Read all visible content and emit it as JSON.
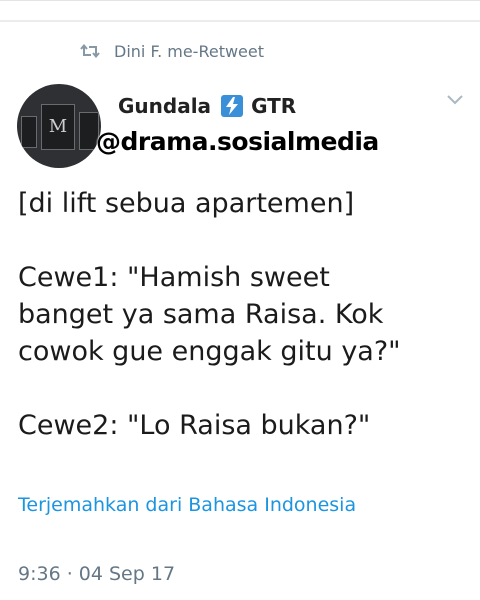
{
  "retweet": {
    "text": "Dini F. me-Retweet",
    "icon": "retweet-icon"
  },
  "author": {
    "name": "Gundala",
    "badge_icon": "lightning-icon",
    "suffix": "GTR",
    "handle_overlay": "@drama.sosialmedia",
    "avatar_letters": [
      "M"
    ]
  },
  "tweet": {
    "lines": [
      "[di lift sebua apartemen]",
      "Cewe1: \"Hamish sweet",
      "banget ya sama Raisa. Kok",
      "cowok gue enggak gitu ya?\"",
      "Cewe2: \"Lo Raisa bukan?\""
    ]
  },
  "translate_label": "Terjemahkan dari Bahasa Indonesia",
  "timestamp": "9:36 · 04 Sep 17",
  "colors": {
    "link": "#1b95e0",
    "muted": "#657786",
    "badge": "#3a8fd9"
  }
}
